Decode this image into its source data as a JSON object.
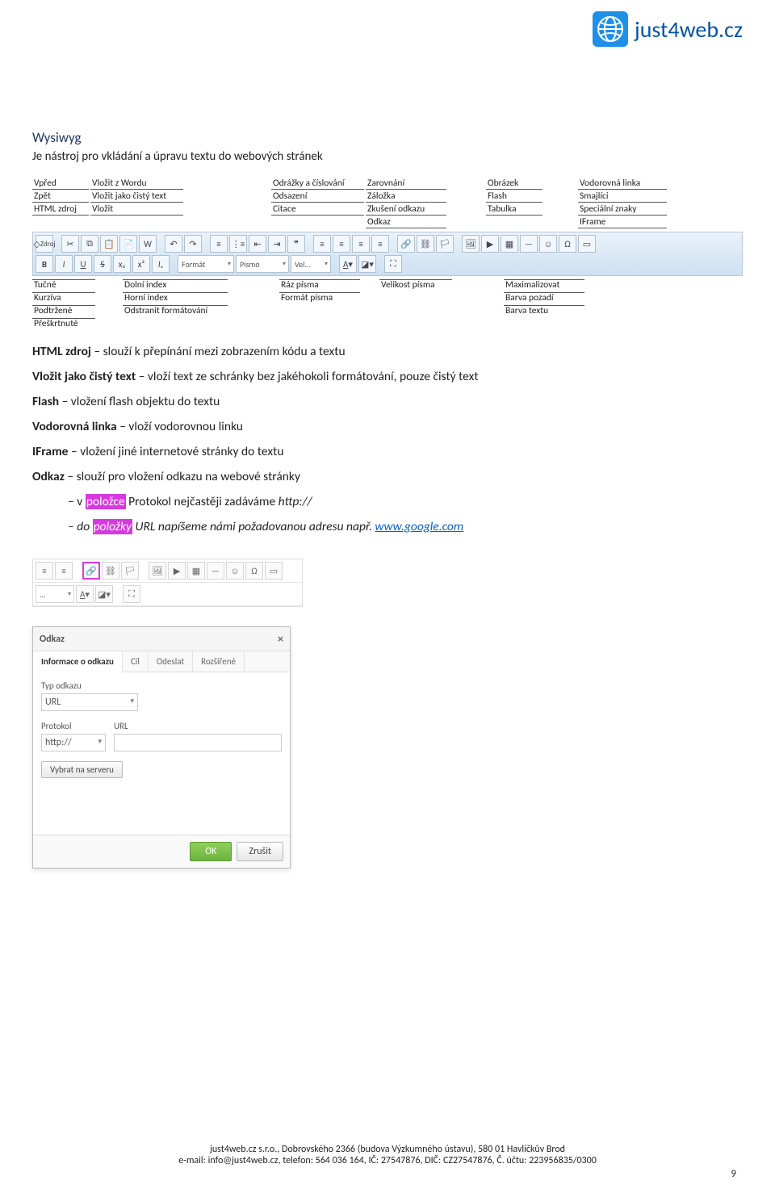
{
  "brand": {
    "name": "just4web",
    "tld": ".cz"
  },
  "heading": "Wysiwyg",
  "intro": "Je nástroj pro vkládání a úpravu textu do webových stránek",
  "diagram": {
    "top_left_col": [
      "Vpřed",
      "Zpět",
      "HTML zdroj"
    ],
    "top_col2": [
      "Vložit z Wordu",
      "Vložit jako čistý text",
      "Vložit"
    ],
    "top_col3": [
      "Odrážky a číslování",
      "Odsazení",
      "Citace"
    ],
    "top_col4": [
      "Zarovnání",
      "Záložka",
      "Zkušení odkazu",
      "Odkaz"
    ],
    "top_col5": [
      "Obrázek",
      "Flash",
      "Tabulka"
    ],
    "top_col6": [
      "Vodorovná linka",
      "Smajlíci",
      "Speciální znaky",
      "IFrame"
    ],
    "toolbar_row1_source": "Zdroj",
    "toolbar_row2_selects": [
      "Formát",
      "Písmo",
      "Vel..."
    ],
    "bottom_left_col": [
      "Tučné",
      "Kurzíva",
      "Podtržené",
      "Přeškrtnuté"
    ],
    "bottom_col2": [
      "Dolní index",
      "Horní index",
      "Odstranit formátování"
    ],
    "bottom_col3": [
      "Formát písma",
      "Ráz písma"
    ],
    "bottom_col4": [
      "Velikost písma"
    ],
    "bottom_col5": [
      "Maximalizovat",
      "Barva pozadí",
      "Barva textu"
    ]
  },
  "body_items": {
    "l1_b": "HTML zdroj",
    "l1_r": " – slouží k přepínání mezi zobrazením kódu a textu",
    "l2_b": "Vložit jako čistý text",
    "l2_r": " – vloží text ze schránky bez jakéhokoli formátování, pouze čistý text",
    "l3_b": "Flash",
    "l3_r": " – vložení flash objektu do textu",
    "l4_b": "Vodorovná linka",
    "l4_r": " – vloží vodorovnou linku",
    "l5_b": "IFrame",
    "l5_r": " – vložení jiné internetové stránky do textu",
    "l6_b": "Odkaz",
    "l6_r": " – slouží pro vložení odkazu na webové stránky",
    "l7_pre": "– v ",
    "l7_hl": "položce",
    "l7_mid": " Protokol nejčastěji zadáváme ",
    "l7_it": "http://",
    "l8_pre": "– do ",
    "l8_hl": "položky",
    "l8_mid": " URL napíšeme námi požadovanou adresu např. ",
    "l8_link": "www.google.com"
  },
  "dialog": {
    "title": "Odkaz",
    "tabs": [
      "Informace o odkazu",
      "Cíl",
      "Odeslat",
      "Rozšířené"
    ],
    "type_label": "Typ odkazu",
    "type_value": "URL",
    "protokol_label": "Protokol",
    "protokol_value": "http://",
    "url_label": "URL",
    "server_btn": "Vybrat na serveru",
    "ok": "OK",
    "cancel": "Zrušit"
  },
  "footer": {
    "line1": "just4web.cz s.r.o., Dobrovského 2366 (budova Výzkumného ústavu), 580 01 Havlíčkův Brod",
    "line2": "e-mail: info@just4web.cz, telefon: 564 036 164, IČ: 27547876, DIČ: CZ27547876, Č. účtu: 223956835/0300",
    "page": "9"
  }
}
